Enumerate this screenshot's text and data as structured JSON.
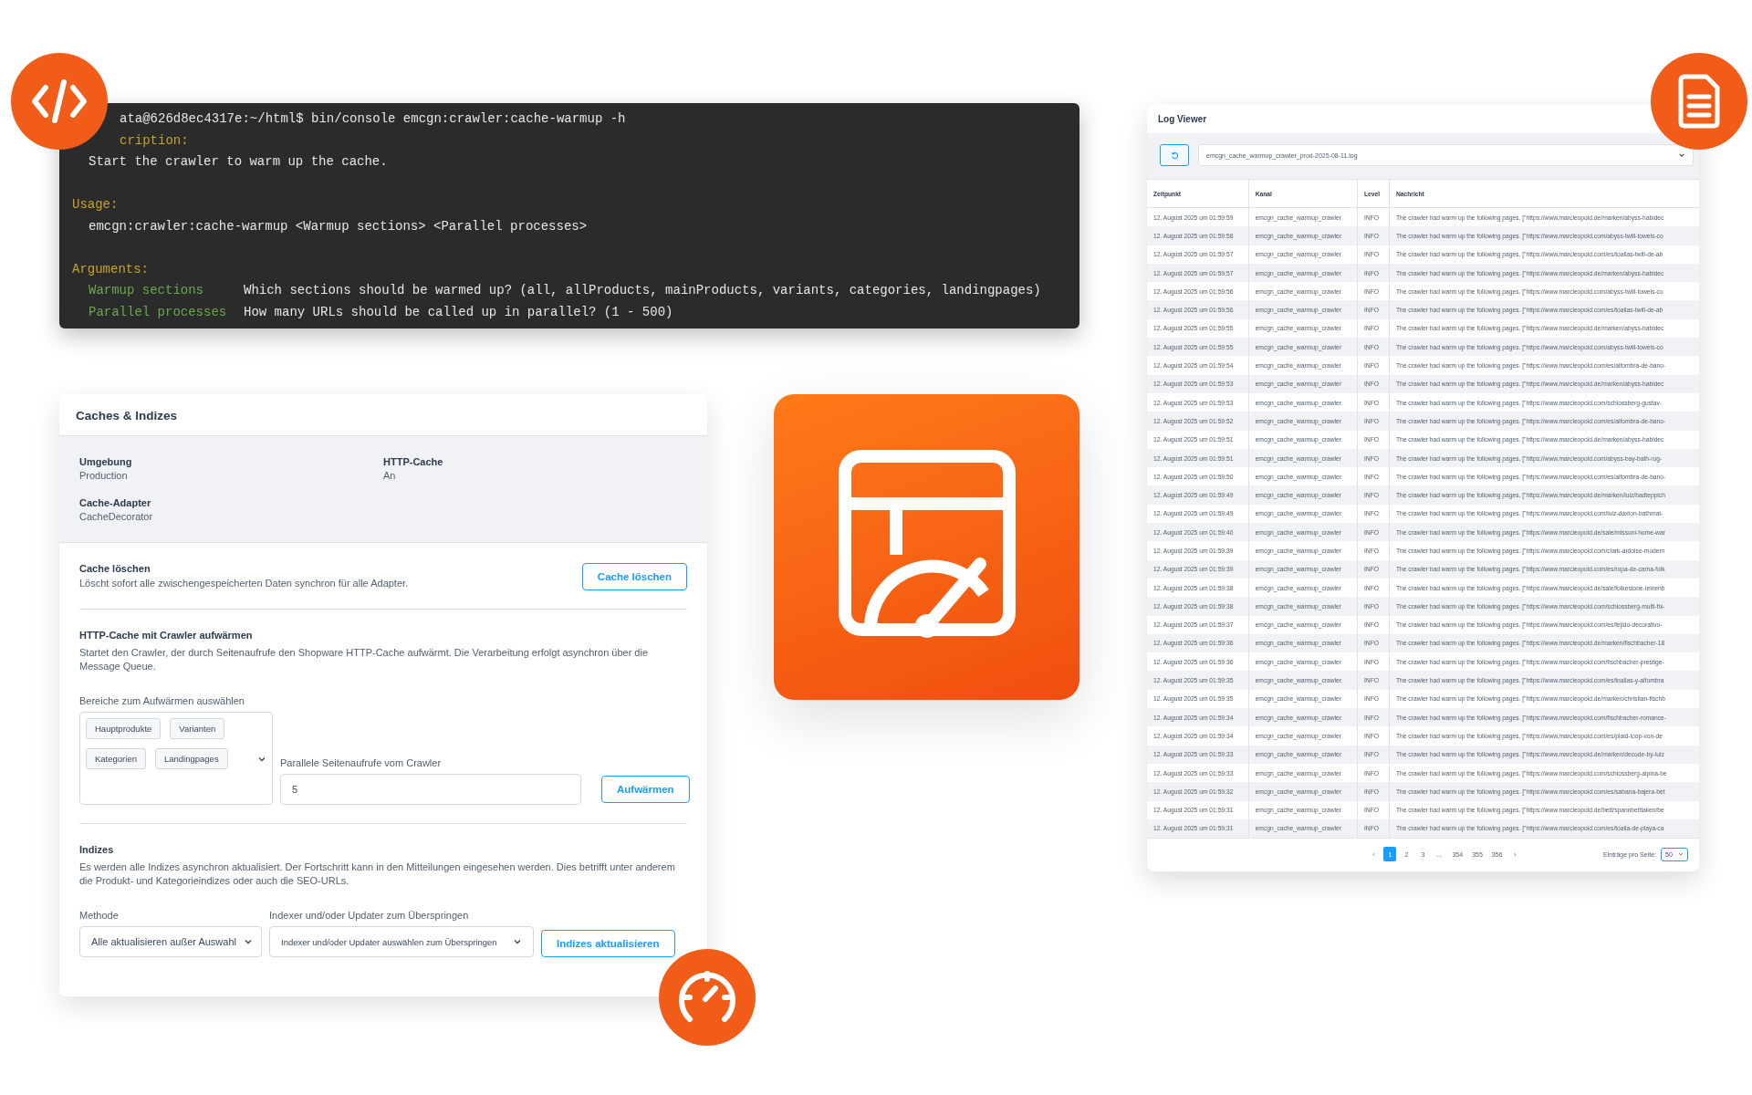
{
  "terminal": {
    "lines": [
      {
        "kind": "command",
        "text": "ata@626d8ec4317e:~/html$ bin/console emcgn:crawler:cache-warmup -h"
      },
      {
        "kind": "heading",
        "text": "cription:"
      },
      {
        "kind": "text",
        "text": "Start the crawler to warm up the cache."
      },
      {
        "kind": "heading",
        "text": "Usage:"
      },
      {
        "kind": "text",
        "text": "emcgn:crawler:cache-warmup <Warmup sections> <Parallel processes>"
      },
      {
        "kind": "heading",
        "text": "Arguments:"
      },
      {
        "kind": "argument",
        "name": "Warmup sections",
        "description": "Which sections should be warmed up? (all, allProducts, mainProducts, variants, categories, landingpages)"
      },
      {
        "kind": "argument",
        "name": "Parallel processes",
        "description": "How many URLs should be called up in parallel? (1 - 500)"
      }
    ]
  },
  "caches": {
    "title": "Caches & Indizes",
    "info": [
      {
        "label": "Umgebung",
        "value": "Production"
      },
      {
        "label": "HTTP-Cache",
        "value": "An"
      },
      {
        "label": "Cache-Adapter",
        "value": "CacheDecorator"
      }
    ],
    "clear": {
      "title": "Cache löschen",
      "text": "Löscht sofort alle zwischengespeicherten Daten synchron für alle Adapter.",
      "button": "Cache löschen"
    },
    "warmup": {
      "title": "HTTP-Cache mit Crawler aufwärmen",
      "text": "Startet den Crawler, der durch Seitenaufrufe den Shopware HTTP-Cache aufwärmt. Die Verarbeitung erfolgt asynchron über die Message Queue.",
      "sections_label": "Bereiche zum Aufwärmen auswählen",
      "sections": [
        "Hauptprodukte",
        "Varianten",
        "Kategorien",
        "Landingpages"
      ],
      "parallel_label": "Parallele Seitenaufrufe vom Crawler",
      "parallel_value": "5",
      "button": "Aufwärmen"
    },
    "indexes": {
      "title": "Indizes",
      "text": "Es werden alle Indizes asynchron aktualisiert. Der Fortschritt kann in den Mitteilungen eingesehen werden. Dies betrifft unter anderem die Produkt- und Kategorieindizes oder auch die SEO-URLs.",
      "method_label": "Methode",
      "method_value": "Alle aktualisieren außer Auswahl",
      "skip_label": "Indexer und/oder Updater zum Überspringen",
      "skip_placeholder": "Indexer und/oder Updater auswählen zum Überspringen",
      "button": "Indizes aktualisieren"
    }
  },
  "log_viewer": {
    "title": "Log Viewer",
    "file": "emcgn_cache_warmup_crawler_prod-2025-08-11.log",
    "columns": [
      "Zeitpunkt",
      "Kanal",
      "Level",
      "Nachricht"
    ],
    "rows": [
      [
        "12. August 2025 um 01:59:59",
        "emcgn_cache_warmup_crawler",
        "INFO",
        "The crawler had warm up the following pages. [\"https://www.marcleopold.de/marken/abyss-habidec"
      ],
      [
        "12. August 2025 um 01:59:58",
        "emcgn_cache_warmup_crawler",
        "INFO",
        "The crawler had warm up the following pages. [\"https://www.marcleopold.com/abyss-twill-towels-co"
      ],
      [
        "12. August 2025 um 01:59:57",
        "emcgn_cache_warmup_crawler",
        "INFO",
        "The crawler had warm up the following pages. [\"https://www.marcleopold.com/es/toallas-twill-de-ab"
      ],
      [
        "12. August 2025 um 01:59:57",
        "emcgn_cache_warmup_crawler",
        "INFO",
        "The crawler had warm up the following pages. [\"https://www.marcleopold.de/marken/abyss-habidec"
      ],
      [
        "12. August 2025 um 01:59:56",
        "emcgn_cache_warmup_crawler",
        "INFO",
        "The crawler had warm up the following pages. [\"https://www.marcleopold.com/abyss-twill-towels-co"
      ],
      [
        "12. August 2025 um 01:59:56",
        "emcgn_cache_warmup_crawler",
        "INFO",
        "The crawler had warm up the following pages. [\"https://www.marcleopold.com/es/toallas-twill-de-ab"
      ],
      [
        "12. August 2025 um 01:59:55",
        "emcgn_cache_warmup_crawler",
        "INFO",
        "The crawler had warm up the following pages. [\"https://www.marcleopold.de/marken/abyss-habidec"
      ],
      [
        "12. August 2025 um 01:59:55",
        "emcgn_cache_warmup_crawler",
        "INFO",
        "The crawler had warm up the following pages. [\"https://www.marcleopold.com/abyss-twill-towels-co"
      ],
      [
        "12. August 2025 um 01:59:54",
        "emcgn_cache_warmup_crawler",
        "INFO",
        "The crawler had warm up the following pages. [\"https://www.marcleopold.com/es/alfombra-de-bano-"
      ],
      [
        "12. August 2025 um 01:59:53",
        "emcgn_cache_warmup_crawler",
        "INFO",
        "The crawler had warm up the following pages. [\"https://www.marcleopold.de/marken/abyss-habidec"
      ],
      [
        "12. August 2025 um 01:59:53",
        "emcgn_cache_warmup_crawler",
        "INFO",
        "The crawler had warm up the following pages. [\"https://www.marcleopold.com/schlossberg-gustav-"
      ],
      [
        "12. August 2025 um 01:59:52",
        "emcgn_cache_warmup_crawler",
        "INFO",
        "The crawler had warm up the following pages. [\"https://www.marcleopold.com/es/alfombra-de-bano-"
      ],
      [
        "12. August 2025 um 01:59:51",
        "emcgn_cache_warmup_crawler",
        "INFO",
        "The crawler had warm up the following pages. [\"https://www.marcleopold.de/marken/abyss-habidec"
      ],
      [
        "12. August 2025 um 01:59:51",
        "emcgn_cache_warmup_crawler",
        "INFO",
        "The crawler had warm up the following pages. [\"https://www.marcleopold.com/abyss-bay-bath-rug-"
      ],
      [
        "12. August 2025 um 01:59:50",
        "emcgn_cache_warmup_crawler",
        "INFO",
        "The crawler had warm up the following pages. [\"https://www.marcleopold.com/es/alfombra-de-bano-"
      ],
      [
        "12. August 2025 um 01:59:49",
        "emcgn_cache_warmup_crawler",
        "INFO",
        "The crawler had warm up the following pages. [\"https://www.marcleopold.de/marken/luiz/badteppich"
      ],
      [
        "12. August 2025 um 01:59:49",
        "emcgn_cache_warmup_crawler",
        "INFO",
        "The crawler had warm up the following pages. [\"https://www.marcleopold.com/luiz-daxton-bathmat-"
      ],
      [
        "12. August 2025 um 01:59:40",
        "emcgn_cache_warmup_crawler",
        "INFO",
        "The crawler had warm up the following pages. [\"https://www.marcleopold.de/sale/missoni-home-war"
      ],
      [
        "12. August 2025 um 01:59:39",
        "emcgn_cache_warmup_crawler",
        "INFO",
        "The crawler had warm up the following pages. [\"https://www.marcleopold.com/clark-ardoise-modern"
      ],
      [
        "12. August 2025 um 01:59:39",
        "emcgn_cache_warmup_crawler",
        "INFO",
        "The crawler had warm up the following pages. [\"https://www.marcleopold.com/es/ropa-de-cama-folk"
      ],
      [
        "12. August 2025 um 01:59:38",
        "emcgn_cache_warmup_crawler",
        "INFO",
        "The crawler had warm up the following pages. [\"https://www.marcleopold.de/sale/folkestone-leinenb"
      ],
      [
        "12. August 2025 um 01:59:38",
        "emcgn_cache_warmup_crawler",
        "INFO",
        "The crawler had warm up the following pages. [\"https://www.marcleopold.com/schlossberg-multi-fix-"
      ],
      [
        "12. August 2025 um 01:59:37",
        "emcgn_cache_warmup_crawler",
        "INFO",
        "The crawler had warm up the following pages. [\"https://www.marcleopold.com/es/tejido-decorativo-"
      ],
      [
        "12. August 2025 um 01:59:36",
        "emcgn_cache_warmup_crawler",
        "INFO",
        "The crawler had warm up the following pages. [\"https://www.marcleopold.de/marken/fischbacher-18"
      ],
      [
        "12. August 2025 um 01:59:36",
        "emcgn_cache_warmup_crawler",
        "INFO",
        "The crawler had warm up the following pages. [\"https://www.marcleopold.com/fischbacher-prestige-"
      ],
      [
        "12. August 2025 um 01:59:35",
        "emcgn_cache_warmup_crawler",
        "INFO",
        "The crawler had warm up the following pages. [\"https://www.marcleopold.com/es/toallas-y-alfombra"
      ],
      [
        "12. August 2025 um 01:59:35",
        "emcgn_cache_warmup_crawler",
        "INFO",
        "The crawler had warm up the following pages. [\"https://www.marcleopold.de/marken/christian-fischb"
      ],
      [
        "12. August 2025 um 01:59:34",
        "emcgn_cache_warmup_crawler",
        "INFO",
        "The crawler had warm up the following pages. [\"https://www.marcleopold.com/fischbacher-romance-"
      ],
      [
        "12. August 2025 um 01:59:34",
        "emcgn_cache_warmup_crawler",
        "INFO",
        "The crawler had warm up the following pages. [\"https://www.marcleopold.com/es/plaid-loop-von-de"
      ],
      [
        "12. August 2025 um 01:59:33",
        "emcgn_cache_warmup_crawler",
        "INFO",
        "The crawler had warm up the following pages. [\"https://www.marcleopold.de/marken/decode-by-luiz"
      ],
      [
        "12. August 2025 um 01:59:33",
        "emcgn_cache_warmup_crawler",
        "INFO",
        "The crawler had warm up the following pages. [\"https://www.marcleopold.com/schlossberg-alpina-be"
      ],
      [
        "12. August 2025 um 01:59:32",
        "emcgn_cache_warmup_crawler",
        "INFO",
        "The crawler had warm up the following pages. [\"https://www.marcleopold.com/es/sabana-bajera-bet"
      ],
      [
        "12. August 2025 um 01:59:31",
        "emcgn_cache_warmup_crawler",
        "INFO",
        "The crawler had warm up the following pages. [\"https://www.marcleopold.de/bett/spannbettlaken/be"
      ],
      [
        "12. August 2025 um 01:59:31",
        "emcgn_cache_warmup_crawler",
        "INFO",
        "The crawler had warm up the following pages. [\"https://www.marcleopold.com/es/toalla-de-playa-ca"
      ]
    ],
    "pagination": {
      "prev": "‹",
      "next": "›",
      "pages": [
        {
          "label": "1",
          "selected": true
        },
        {
          "label": "2",
          "selected": false
        },
        {
          "label": "3",
          "selected": false
        },
        {
          "label": "…",
          "selected": false
        },
        {
          "label": "354",
          "selected": false
        },
        {
          "label": "355",
          "selected": false
        },
        {
          "label": "356",
          "selected": false
        }
      ],
      "per_page_label": "Einträge pro Seite:",
      "per_page": "50"
    }
  }
}
